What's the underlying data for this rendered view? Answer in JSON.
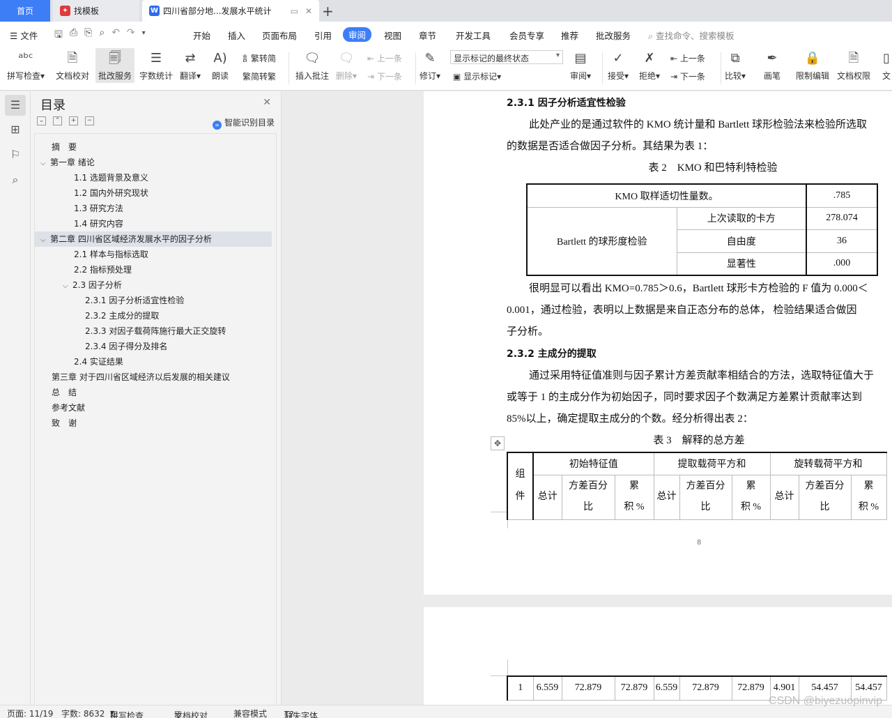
{
  "tabs": {
    "home": "首页",
    "templates": "找模板",
    "document": "四川省部分地...发展水平统计"
  },
  "menu": {
    "file": "文件",
    "items": [
      "开始",
      "插入",
      "页面布局",
      "引用",
      "审阅",
      "视图",
      "章节",
      "开发工具",
      "会员专享",
      "推荐",
      "批改服务"
    ],
    "active": "审阅",
    "search": "查找命令、搜索模板"
  },
  "ribbon": {
    "spell_check": "拼写检查",
    "doc_proof": "文档校对",
    "correction_service": "批改服务",
    "word_count": "字数统计",
    "translate": "翻译",
    "read_aloud": "朗读",
    "trad_to_simp": "繁转简",
    "simp_to_trad": "简转繁",
    "insert_comment": "插入批注",
    "delete": "删除",
    "prev": "上一条",
    "next": "下一条",
    "revise": "修订",
    "markup_state": "显示标记的最终状态",
    "show_markup": "显示标记",
    "review": "审阅",
    "accept": "接受",
    "reject": "拒绝",
    "prev2": "上一条",
    "next2": "下一条",
    "compare": "比较",
    "pen": "画笔",
    "restrict_edit": "限制编辑",
    "doc_permission": "文档权限",
    "doc_cut": "文"
  },
  "toc": {
    "title": "目录",
    "smart_label": "智能识别目录",
    "items": [
      {
        "label": "摘　要",
        "level": 0
      },
      {
        "label": "第一章 绪论",
        "level": 0,
        "caret": true
      },
      {
        "label": "1.1  选题背景及意义",
        "level": 1
      },
      {
        "label": "1.2  国内外研究现状",
        "level": 1
      },
      {
        "label": "1.3  研究方法",
        "level": 1
      },
      {
        "label": "1.4  研究内容",
        "level": 1
      },
      {
        "label": "第二章 四川省区域经济发展水平的因子分析",
        "level": 0,
        "caret": true,
        "active": true
      },
      {
        "label": "2.1  样本与指标选取",
        "level": 1
      },
      {
        "label": "2.2  指标预处理",
        "level": 1
      },
      {
        "label": "2.3  因子分析",
        "level": 1,
        "caret": true
      },
      {
        "label": "2.3.1  因子分析适宜性检验",
        "level": 2
      },
      {
        "label": "2.3.2 主成分的提取",
        "level": 2
      },
      {
        "label": "2.3.3 对因子载荷阵施行最大正交旋转",
        "level": 2
      },
      {
        "label": "2.3.4  因子得分及排名",
        "level": 2
      },
      {
        "label": "2.4  实证结果",
        "level": 1
      },
      {
        "label": "第三章 对于四川省区域经济以后发展的相关建议",
        "level": 0
      },
      {
        "label": "总　结",
        "level": 0
      },
      {
        "label": "参考文献",
        "level": 0
      },
      {
        "label": "致　谢",
        "level": 0
      }
    ]
  },
  "doc": {
    "h231": "2.3.1  因子分析适宜性检验",
    "p1a": "此处产业的是通过软件的 KMO 统计量和 Bartlett 球形检验法来检验所选取",
    "p1b": "的数据是否适合做因子分析。其结果为表 1：",
    "table2_caption": "表 2　KMO  和巴特利特检验",
    "kmo_label": "KMO  取样适切性量数。",
    "kmo_value": ".785",
    "bartlett_label": "Bartlett  的球形度检验",
    "chi_label": "上次读取的卡方",
    "chi_value": "278.074",
    "df_label": "自由度",
    "df_value": "36",
    "sig_label": "显著性",
    "sig_value": ".000",
    "p2a": "很明显可以看出 KMO=0.785＞0.6，Bartlett 球形卡方检验的 F 值为 0.000＜",
    "p2b": "0.001，通过检验，表明以上数据是来自正态分布的总体，  检验结果适合做因",
    "p2c": "子分析。",
    "h232": "2.3.2  主成分的提取",
    "p3a": "通过采用特征值准则与因子累计方差贡献率相结合的方法，选取特征值大于",
    "p3b": "或等于 1 的主成分作为初始因子，同时要求因子个数满足方差累计贡献率达到",
    "p3c": "85%以上，确定提取主成分的个数。经分析得出表 2：",
    "table3_caption": "表 3　解释的总方差",
    "t3_component": [
      "组",
      "件"
    ],
    "t3_groups": [
      "初始特征值",
      "提取载荷平方和",
      "旋转载荷平方和"
    ],
    "t3_total": "总计",
    "t3_pct": [
      "方差百分",
      "比"
    ],
    "t3_cum": [
      "累",
      "积 %"
    ],
    "page_number": "8",
    "row1": [
      "1",
      "6.559",
      "72.879",
      "72.879",
      "6.559",
      "72.879",
      "72.879",
      "4.901",
      "54.457",
      "54.457"
    ]
  },
  "status": {
    "page": "页面: 11/19",
    "words": "字数: 8632",
    "spell": "拼写检查",
    "proof": "文档校对",
    "compat": "兼容模式",
    "missing_font": "缺失字体"
  },
  "watermark": "CSDN @biyezuopinvip"
}
